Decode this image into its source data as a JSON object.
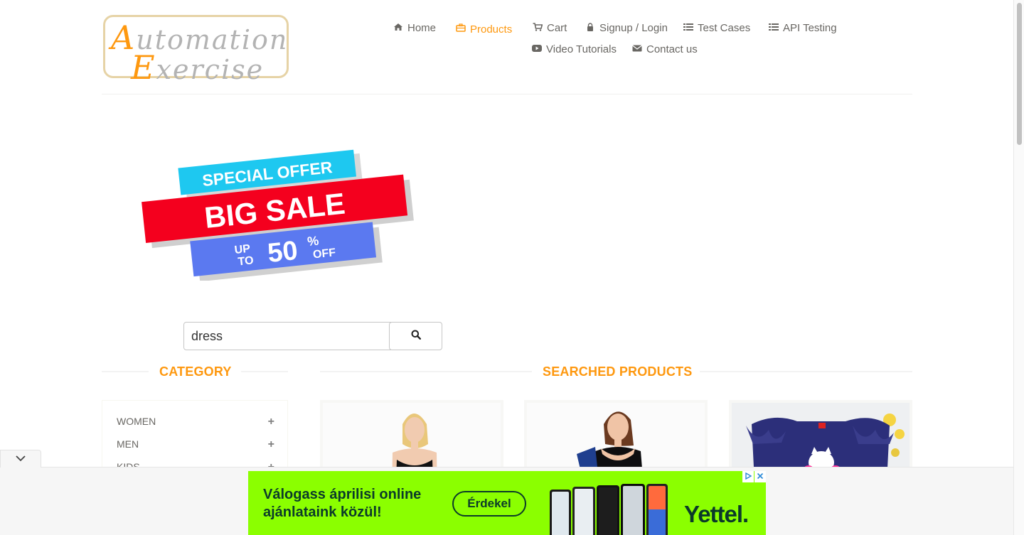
{
  "logo": {
    "line1_cap": "A",
    "line1_rest": "utomation",
    "line2_cap": "E",
    "line2_rest": "xercise"
  },
  "nav": [
    {
      "label": "Home",
      "icon": "home-icon",
      "active": false
    },
    {
      "label": "Products",
      "icon": "briefcase-icon",
      "active": true
    },
    {
      "label": "Cart",
      "icon": "shopping-cart-icon",
      "active": false
    },
    {
      "label": "Signup / Login",
      "icon": "lock-icon",
      "active": false
    },
    {
      "label": "Test Cases",
      "icon": "list-icon",
      "active": false
    },
    {
      "label": "API Testing",
      "icon": "list-icon",
      "active": false
    },
    {
      "label": "Video Tutorials",
      "icon": "youtube-play-icon",
      "active": false
    },
    {
      "label": "Contact us",
      "icon": "envelope-icon",
      "active": false
    }
  ],
  "banner": {
    "line1": "SPECIAL OFFER",
    "line2": "BIG SALE",
    "line3a": "UP",
    "line3b": "TO",
    "line3c": "50",
    "line3d": "%",
    "line3e": "OFF"
  },
  "search": {
    "value": "dress",
    "button_icon": "search-icon"
  },
  "sections": {
    "category": "Category",
    "products": "Searched Products"
  },
  "categories": [
    {
      "label": "Women"
    },
    {
      "label": "Men"
    },
    {
      "label": "Kids"
    }
  ],
  "ad": {
    "headline": "Válogass áprilisi online ajánlataink közül!",
    "cta": "Érdekel",
    "brand": "Yettel",
    "brand_dot": ".",
    "colors": {
      "background": "#8bff00",
      "text": "#0b3a2a"
    }
  },
  "colors": {
    "accent": "#fe980f",
    "text": "#696763"
  }
}
